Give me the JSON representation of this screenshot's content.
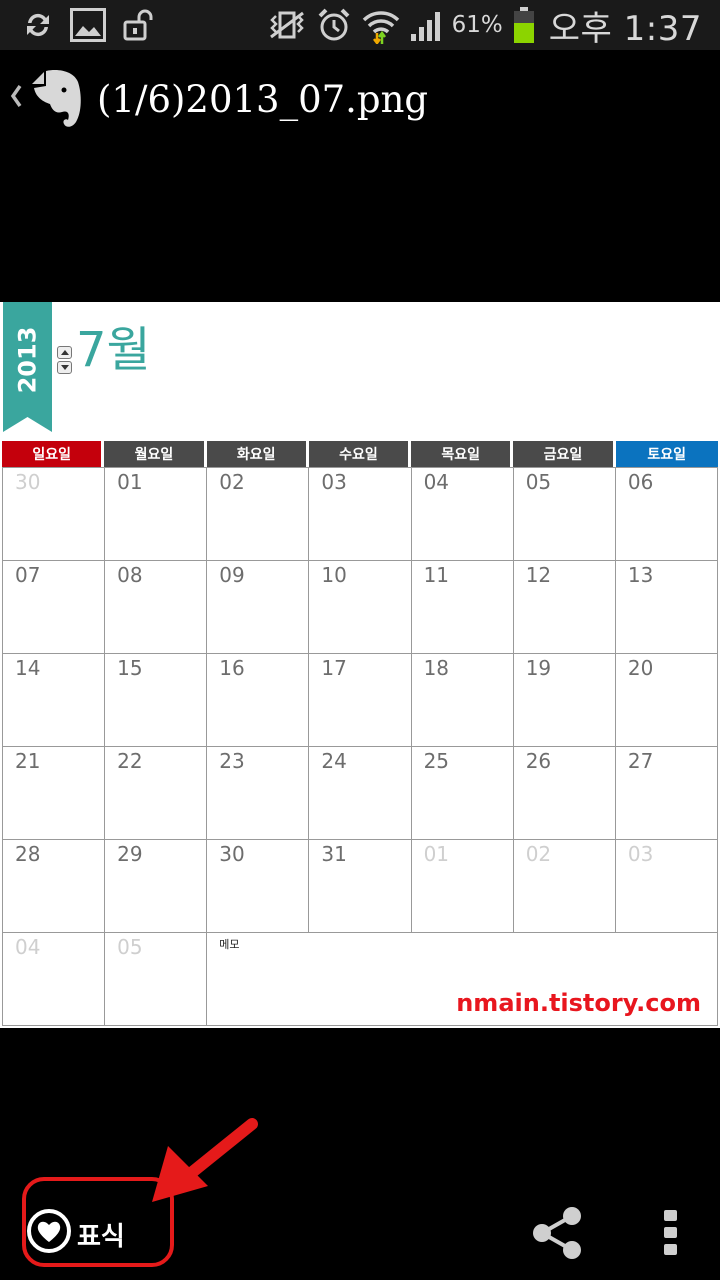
{
  "status_bar": {
    "battery_percent": "61%",
    "time": "오후 1:37",
    "icons": [
      "sync-icon",
      "gallery-icon",
      "unlock-icon",
      "vibrate-icon",
      "alarm-icon",
      "wifi-icon",
      "signal-icon",
      "battery-icon"
    ]
  },
  "action_bar": {
    "title": "(1/6)2013_07.png",
    "icons": [
      "back-chevron-icon",
      "evernote-elephant-icon"
    ]
  },
  "calendar": {
    "year": "2013",
    "month": "7월",
    "day_headers": [
      {
        "label": "일요일",
        "color": "#c4000c"
      },
      {
        "label": "월요일",
        "color": "#4a4a4a"
      },
      {
        "label": "화요일",
        "color": "#4a4a4a"
      },
      {
        "label": "수요일",
        "color": "#4a4a4a"
      },
      {
        "label": "목요일",
        "color": "#4a4a4a"
      },
      {
        "label": "금요일",
        "color": "#4a4a4a"
      },
      {
        "label": "토요일",
        "color": "#0b73bf"
      }
    ],
    "weeks": [
      [
        {
          "d": "30",
          "muted": true
        },
        {
          "d": "01"
        },
        {
          "d": "02"
        },
        {
          "d": "03"
        },
        {
          "d": "04"
        },
        {
          "d": "05"
        },
        {
          "d": "06"
        }
      ],
      [
        {
          "d": "07"
        },
        {
          "d": "08"
        },
        {
          "d": "09"
        },
        {
          "d": "10"
        },
        {
          "d": "11"
        },
        {
          "d": "12"
        },
        {
          "d": "13"
        }
      ],
      [
        {
          "d": "14"
        },
        {
          "d": "15"
        },
        {
          "d": "16"
        },
        {
          "d": "17"
        },
        {
          "d": "18"
        },
        {
          "d": "19"
        },
        {
          "d": "20"
        }
      ],
      [
        {
          "d": "21"
        },
        {
          "d": "22"
        },
        {
          "d": "23"
        },
        {
          "d": "24"
        },
        {
          "d": "25"
        },
        {
          "d": "26"
        },
        {
          "d": "27"
        }
      ],
      [
        {
          "d": "28"
        },
        {
          "d": "29"
        },
        {
          "d": "30"
        },
        {
          "d": "31"
        },
        {
          "d": "01",
          "muted": true
        },
        {
          "d": "02",
          "muted": true
        },
        {
          "d": "03",
          "muted": true
        }
      ],
      [
        {
          "d": "04",
          "muted": true
        },
        {
          "d": "05",
          "muted": true
        }
      ]
    ],
    "memo_label": "메모",
    "watermark": "nmain.tistory.com",
    "accent_color": "#3aa69e"
  },
  "bottom_bar": {
    "mark_label": "표식",
    "icons": [
      "heart-mark-icon",
      "share-icon",
      "overflow-menu-icon"
    ]
  },
  "annotation": {
    "highlight_color": "#e51a1a"
  }
}
